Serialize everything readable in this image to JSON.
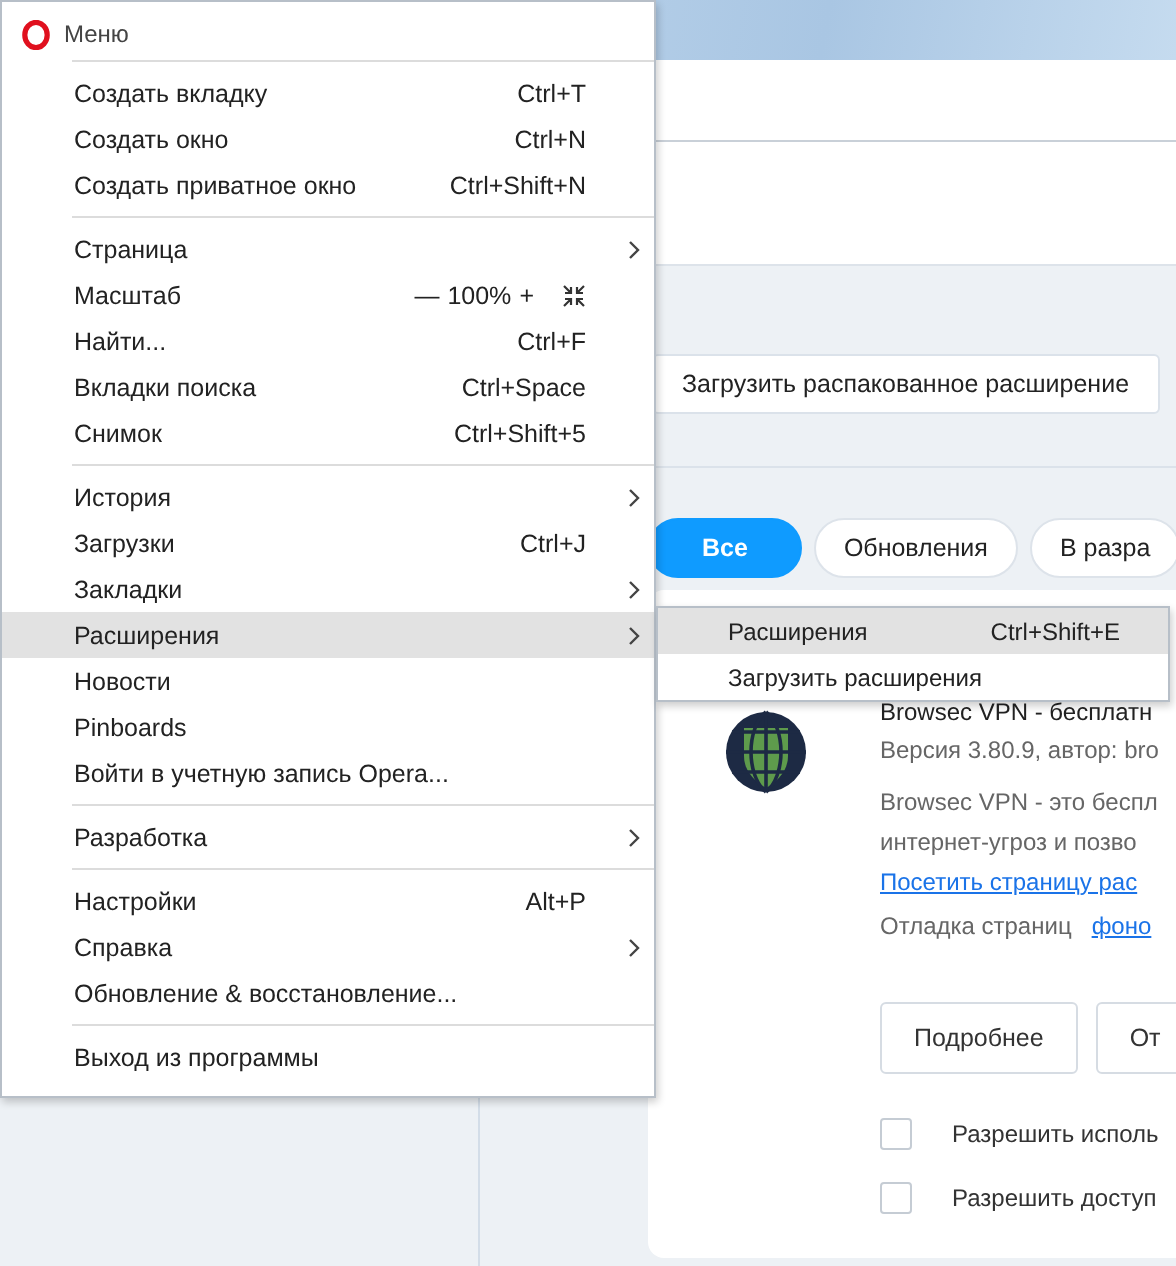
{
  "page": {
    "load_unpacked_button": "Загрузить распакованное расширение",
    "filters": [
      {
        "label": "Все",
        "selected": true
      },
      {
        "label": "Обновления",
        "selected": false
      },
      {
        "label": "В разра",
        "selected": false
      }
    ],
    "extension": {
      "name": "Browsec VPN - бесплатн",
      "version": "Версия 3.80.9, автор: bro",
      "description": [
        "Browsec VPN - это беспл",
        "интернет-угроз и позво"
      ],
      "link": "Посетить страницу рас",
      "debug_label": "Отладка страниц",
      "debug_link": "фоно",
      "buttons": [
        "Подробнее",
        "От"
      ],
      "checkboxes": [
        {
          "label": "Разрешить исполь",
          "checked": false
        },
        {
          "label": "Разрешить доступ",
          "checked": false
        }
      ]
    }
  },
  "menu": {
    "title": "Меню",
    "sections": [
      [
        {
          "kind": "command",
          "label": "Создать вкладку",
          "shortcut": "Ctrl+T",
          "has_submenu": false,
          "selected": false
        },
        {
          "kind": "command",
          "label": "Создать окно",
          "shortcut": "Ctrl+N",
          "has_submenu": false,
          "selected": false
        },
        {
          "kind": "command",
          "label": "Создать приватное окно",
          "shortcut": "Ctrl+Shift+N",
          "has_submenu": false,
          "selected": false
        }
      ],
      [
        {
          "kind": "command",
          "label": "Страница",
          "has_submenu": true,
          "selected": false
        },
        {
          "kind": "zoom",
          "label": "Масштаб",
          "minus": "—",
          "value": "100%",
          "plus": "+",
          "has_submenu": false,
          "selected": false
        },
        {
          "kind": "command",
          "label": "Найти...",
          "shortcut": "Ctrl+F",
          "has_submenu": false,
          "selected": false
        },
        {
          "kind": "command",
          "label": "Вкладки поиска",
          "shortcut": "Ctrl+Space",
          "has_submenu": false,
          "selected": false
        },
        {
          "kind": "command",
          "label": "Снимок",
          "shortcut": "Ctrl+Shift+5",
          "has_submenu": false,
          "selected": false
        }
      ],
      [
        {
          "kind": "command",
          "label": "История",
          "has_submenu": true,
          "selected": false
        },
        {
          "kind": "command",
          "label": "Загрузки",
          "shortcut": "Ctrl+J",
          "has_submenu": false,
          "selected": false
        },
        {
          "kind": "command",
          "label": "Закладки",
          "has_submenu": true,
          "selected": false
        },
        {
          "kind": "command",
          "label": "Расширения",
          "has_submenu": true,
          "selected": true
        },
        {
          "kind": "command",
          "label": "Новости",
          "has_submenu": false,
          "selected": false
        },
        {
          "kind": "command",
          "label": "Pinboards",
          "has_submenu": false,
          "selected": false
        },
        {
          "kind": "command",
          "label": "Войти в учетную запись Opera...",
          "has_submenu": false,
          "selected": false
        }
      ],
      [
        {
          "kind": "command",
          "label": "Разработка",
          "has_submenu": true,
          "selected": false
        }
      ],
      [
        {
          "kind": "command",
          "label": "Настройки",
          "shortcut": "Alt+P",
          "has_submenu": false,
          "selected": false
        },
        {
          "kind": "command",
          "label": "Справка",
          "has_submenu": true,
          "selected": false
        },
        {
          "kind": "command",
          "label": "Обновление & восстановление...",
          "has_submenu": false,
          "selected": false
        }
      ],
      [
        {
          "kind": "command",
          "label": "Выход из программы",
          "has_submenu": false,
          "selected": false
        }
      ]
    ],
    "submenu": [
      {
        "label": "Расширения",
        "shortcut": "Ctrl+Shift+E",
        "selected": true
      },
      {
        "label": "Загрузить расширения",
        "selected": false
      }
    ]
  }
}
